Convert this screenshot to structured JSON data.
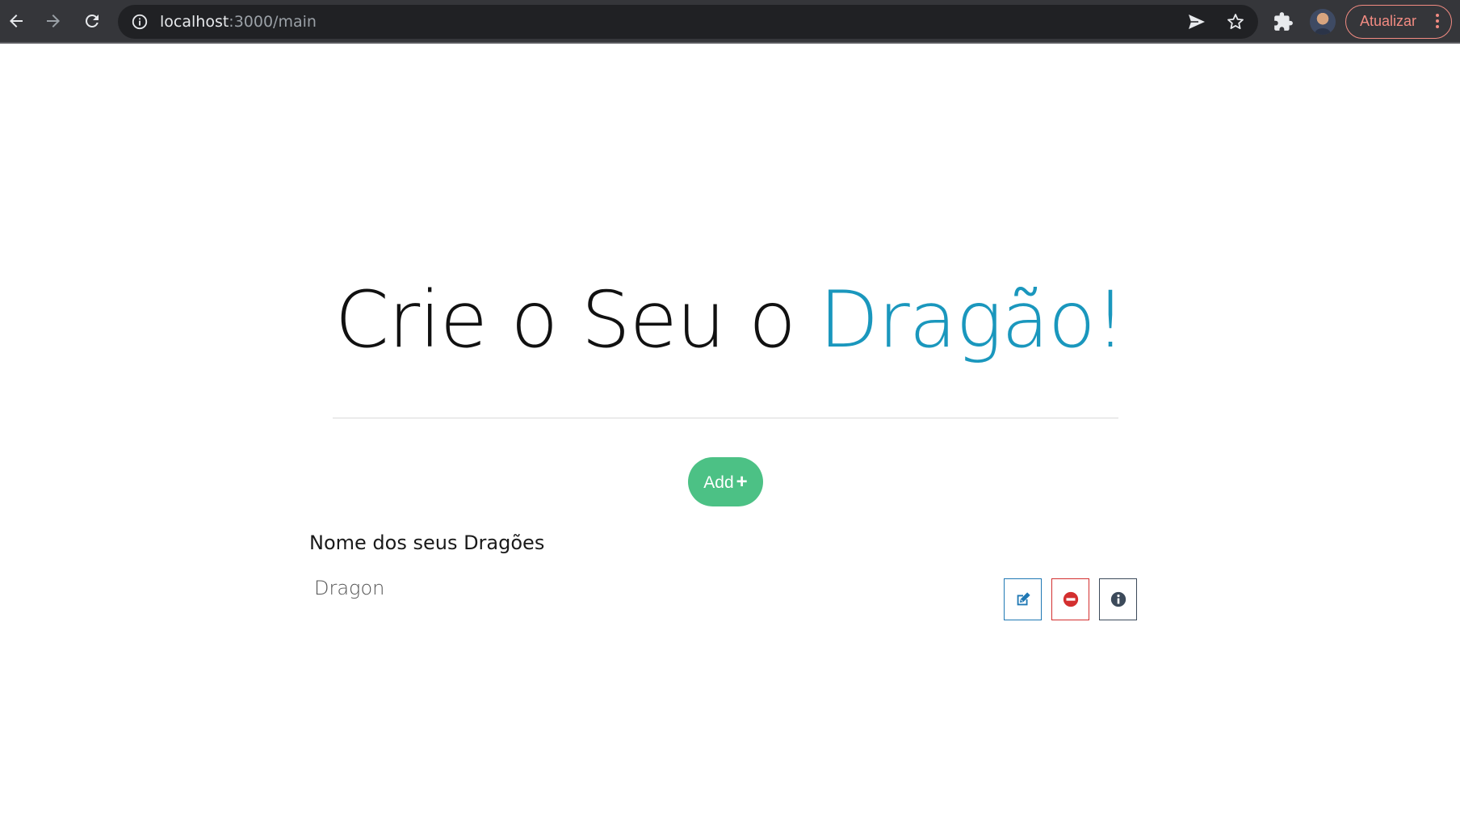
{
  "browser": {
    "url_host": "localhost",
    "url_path": ":3000/main",
    "update_label": "Atualizar",
    "icons": {
      "back": "arrow-left-icon",
      "forward": "arrow-right-icon",
      "reload": "reload-icon",
      "site_info": "info-circle-icon",
      "send": "send-icon",
      "bookmark": "star-icon",
      "extensions": "puzzle-icon",
      "menu": "three-dots-icon"
    },
    "colors": {
      "toolbar": "#35363a",
      "omnibox": "#202124",
      "update_accent": "#f28b82"
    }
  },
  "page": {
    "headline_part1": "Crie o Seu o ",
    "headline_accent": "Dragão!",
    "add_label": "Add",
    "add_plus": "+",
    "list_title": "Nome dos seus Dragões",
    "dragons": [
      {
        "name": "Dragon",
        "actions": [
          "edit-icon",
          "delete-icon",
          "info-icon"
        ]
      }
    ],
    "colors": {
      "accent": "#1a97bd",
      "add_button": "#4cc185",
      "edit": "#1f78b4",
      "delete": "#d32f2f",
      "info": "#3c4a5a"
    }
  }
}
